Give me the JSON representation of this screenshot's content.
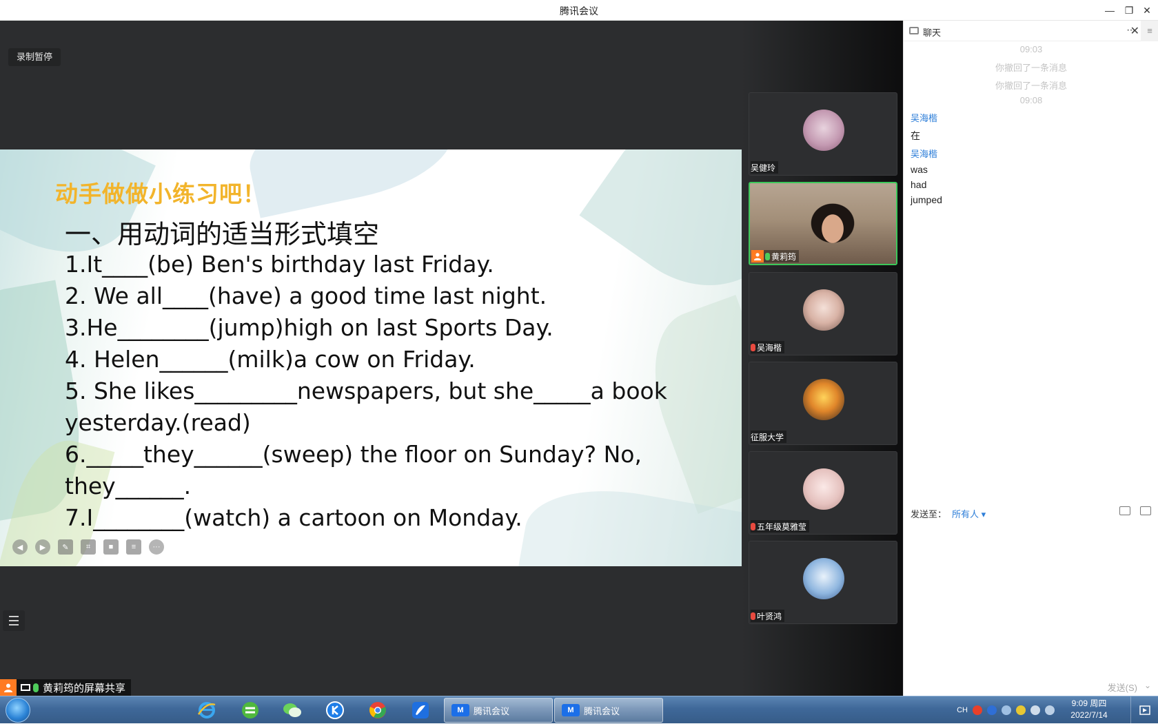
{
  "window": {
    "title": "腾讯会议",
    "minimize_label": "—",
    "restore_label": "❐",
    "close_label": "✕"
  },
  "meeting": {
    "recording_status": "录制暂停",
    "share_label": "黄莉筠的屏幕共享"
  },
  "slide": {
    "heading": "动手做做小练习吧！",
    "subtitle": "一、用动词的适当形式填空",
    "lines": [
      "1.It____(be) Ben's birthday last Friday.",
      "2. We all____(have) a good time last night.",
      "3.He________(jump)high on last Sports Day.",
      "4. Helen______(milk)a cow on Friday.",
      "5. She likes_________newspapers, but she_____a book",
      "yesterday.(read)",
      "6._____they______(sweep) the floor on Sunday? No,",
      "they______.",
      "7.I________(watch) a cartoon on Monday."
    ],
    "tools": [
      "prev-icon",
      "next-icon",
      "pen-icon",
      "screenshot-icon",
      "camera-icon",
      "comment-icon",
      "more-icon"
    ]
  },
  "participants": [
    {
      "name": "吴健玲",
      "mic": "none",
      "avatar_color": "#c9a2b7"
    },
    {
      "name": "黄莉筠",
      "mic": "on",
      "host": true,
      "video": true
    },
    {
      "name": "吴海楷",
      "mic": "muted",
      "avatar_color": "#e7c9bf"
    },
    {
      "name": "征服大学",
      "mic": "none",
      "avatar_color": "#d58a2a"
    },
    {
      "name": "五年级莫雅莹",
      "mic": "muted",
      "avatar_color": "#e6c3c0"
    },
    {
      "name": "叶贤鸿",
      "mic": "muted",
      "avatar_color": "#8fb6df"
    }
  ],
  "chat": {
    "title": "聊天",
    "more_label": "···",
    "close_label": "✕",
    "side_label": "≡",
    "items": [
      {
        "type": "time",
        "text": "09:03"
      },
      {
        "type": "system",
        "text": "你撤回了一条消息"
      },
      {
        "type": "system",
        "text": "你撤回了一条消息"
      },
      {
        "type": "time",
        "text": "09:08"
      },
      {
        "type": "sender",
        "text": "吴海楷"
      },
      {
        "type": "message",
        "text": "在"
      },
      {
        "type": "sender",
        "text": "吴海楷"
      },
      {
        "type": "message",
        "text": "was"
      },
      {
        "type": "message",
        "text": "had"
      },
      {
        "type": "message",
        "text": "jumped"
      }
    ],
    "send_to_label": "发送至：",
    "send_to_value": "所有人 ▾",
    "send_button": "发送(S)",
    "send_dropdown": "⌄"
  },
  "taskbar": {
    "apps": [
      "ie-icon",
      "360-icon",
      "wechat-icon",
      "kugou-icon",
      "chrome-icon",
      "feishu-icon"
    ],
    "windows": [
      {
        "label": "腾讯会议",
        "logo": "M"
      },
      {
        "label": "腾讯会议",
        "logo": "M"
      }
    ],
    "tray_lang": "CH",
    "clock_time": "9:09 周四",
    "clock_date": "2022/7/14"
  }
}
